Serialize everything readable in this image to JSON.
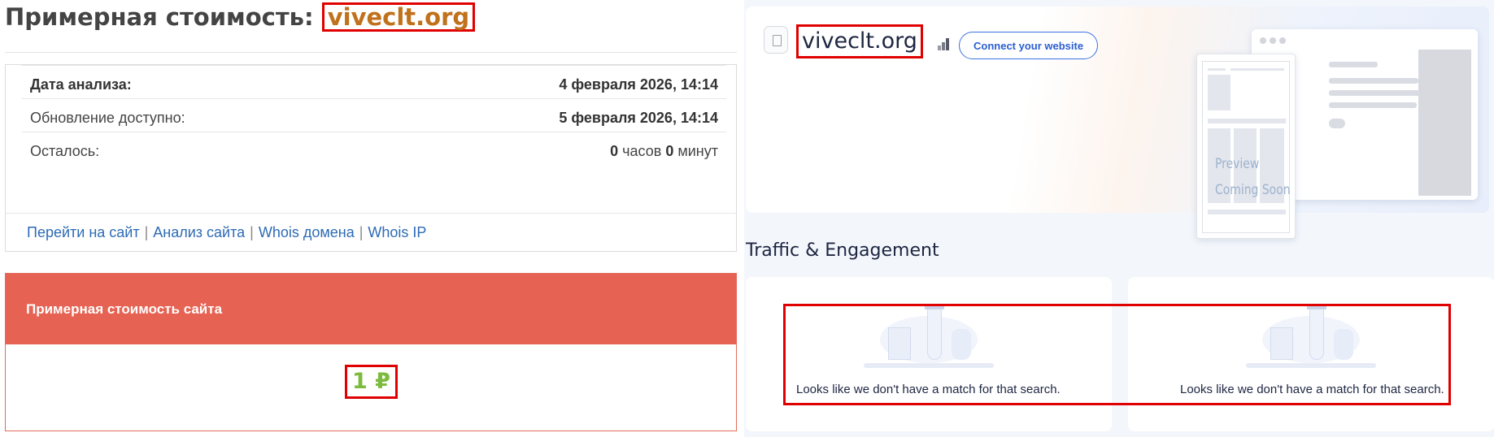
{
  "left": {
    "title_prefix": "Примерная стоимость:",
    "title_domain": "viveclt.org",
    "info": [
      {
        "label": "Дата анализа:",
        "value": "4 февраля 2026, 14:14"
      },
      {
        "label": "Обновление доступно:",
        "value": "5 февраля 2026, 14:14"
      }
    ],
    "remaining": {
      "label": "Осталось:",
      "hours": "0",
      "hours_unit": "часов",
      "minutes": "0",
      "minutes_unit": "минут"
    },
    "links": [
      "Перейти на сайт",
      "Анализ сайта",
      "Whois домена",
      "Whois IP"
    ],
    "links_separator": "|",
    "cost_header": "Примерная стоимость сайта",
    "cost_value": "1 ₽"
  },
  "right": {
    "favicon_icon": "document-icon",
    "site_name": "viveclt.org",
    "rank_icon": "bar-chart-icon",
    "connect_button": "Connect your website",
    "preview_line1": "Preview",
    "preview_line2": "Coming Soon",
    "section_title": "Traffic & Engagement",
    "empty_message_1": "Looks like we don't have a match for that search.",
    "empty_message_2": "Looks like we don't have a match for that search."
  },
  "colors": {
    "highlight_border": "#e00000",
    "domain_orange": "#c0711c",
    "cost_header_bg": "#e66252",
    "cost_value_green": "#7dbb3f",
    "link_blue": "#2d6bb5",
    "connect_blue": "#2b5fd0"
  }
}
